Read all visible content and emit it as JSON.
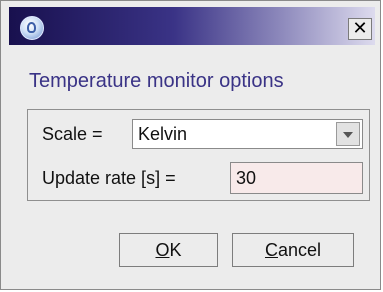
{
  "window": {
    "title": "",
    "app_icon": "java-duke-icon",
    "close_glyph": "✕"
  },
  "dialog": {
    "heading": "Temperature monitor options"
  },
  "scale": {
    "label": "Scale =",
    "selected": "Kelvin"
  },
  "update_rate": {
    "label": "Update rate [s] =",
    "value": "30"
  },
  "buttons": {
    "ok_mnemonic": "O",
    "ok_rest": "K",
    "cancel_mnemonic": "C",
    "cancel_rest": "ancel"
  },
  "colors": {
    "title_gradient_start": "#18104e",
    "heading_text": "#3a3386",
    "input_background": "#f8eaea"
  }
}
